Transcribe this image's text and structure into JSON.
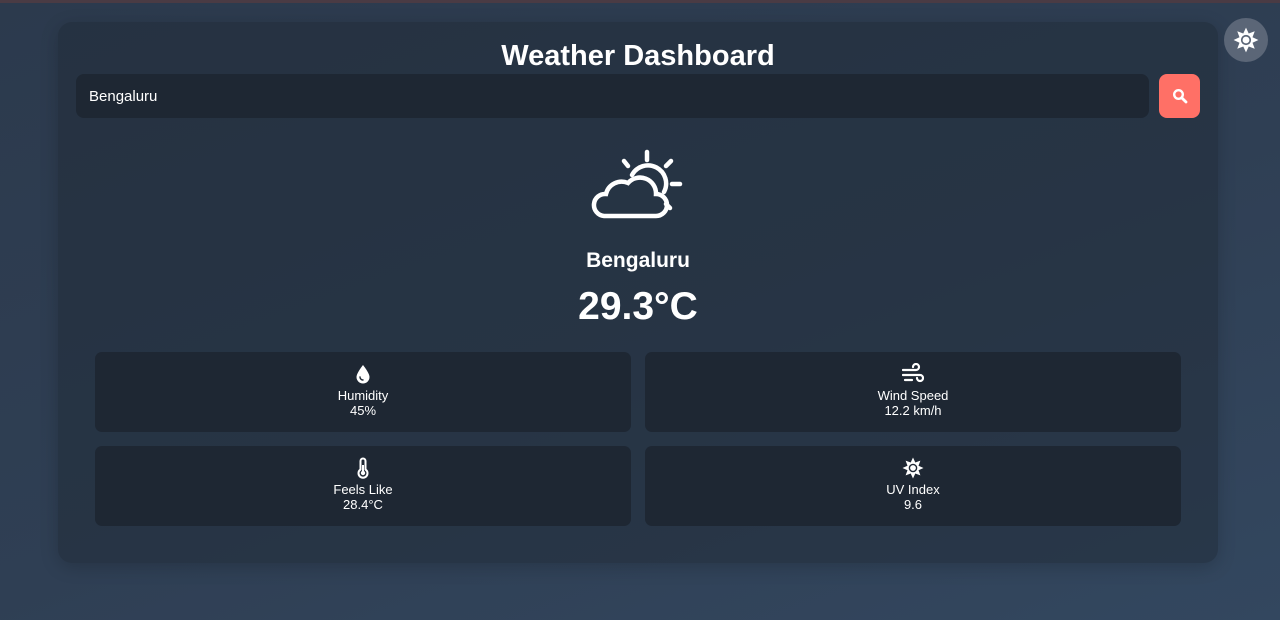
{
  "header": {
    "title": "Weather Dashboard"
  },
  "search": {
    "value": "Bengaluru",
    "button_icon": "search-icon"
  },
  "current": {
    "icon": "partly-cloudy-sun-icon",
    "city": "Bengaluru",
    "temperature": "29.3°C"
  },
  "stats": {
    "humidity": {
      "icon": "droplet-icon",
      "label": "Humidity",
      "value": "45%"
    },
    "wind": {
      "icon": "wind-icon",
      "label": "Wind Speed",
      "value": "12.2 km/h"
    },
    "feels_like": {
      "icon": "thermometer-icon",
      "label": "Feels Like",
      "value": "28.4°C"
    },
    "uv": {
      "icon": "sun-icon",
      "label": "UV Index",
      "value": "9.6"
    }
  },
  "theme_toggle": {
    "icon": "sun-icon"
  },
  "colors": {
    "accent": "#ff7066",
    "panel": "#1e2733",
    "background": "#2f3f54",
    "text": "#ffffff"
  }
}
